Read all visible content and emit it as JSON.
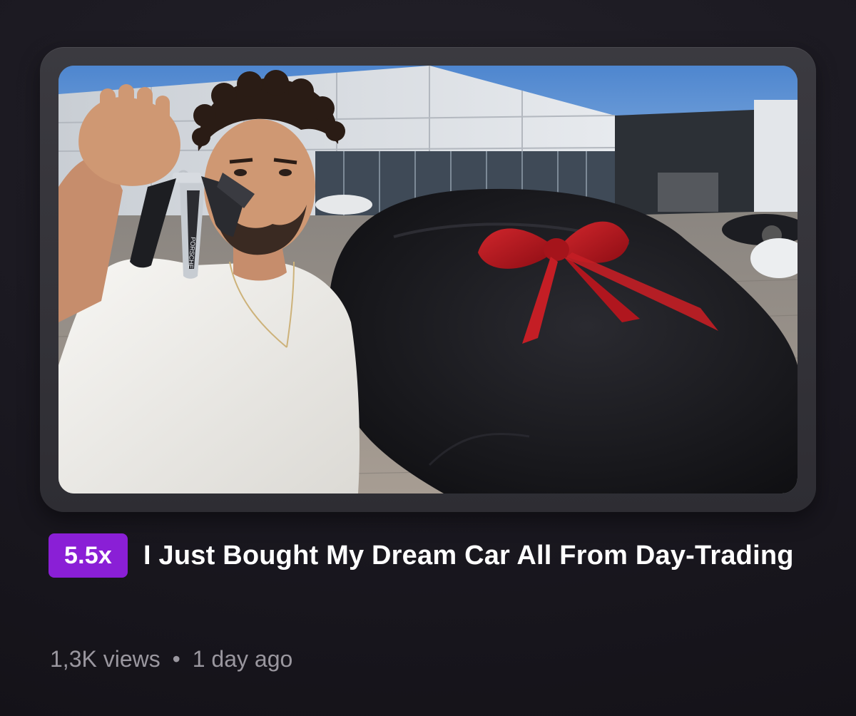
{
  "video": {
    "speed_badge": "5.5x",
    "title": "I Just Bought My Dream Car All From Day-Trading",
    "views": "1,3K views",
    "separator": "•",
    "age": "1 day ago",
    "thumbnail_key_brand": "PORSCHE"
  },
  "colors": {
    "badge": "#8a1fd6",
    "background": "#1a1820",
    "ribbon": "#b0161e",
    "car_cover": "#1b1b1f"
  }
}
